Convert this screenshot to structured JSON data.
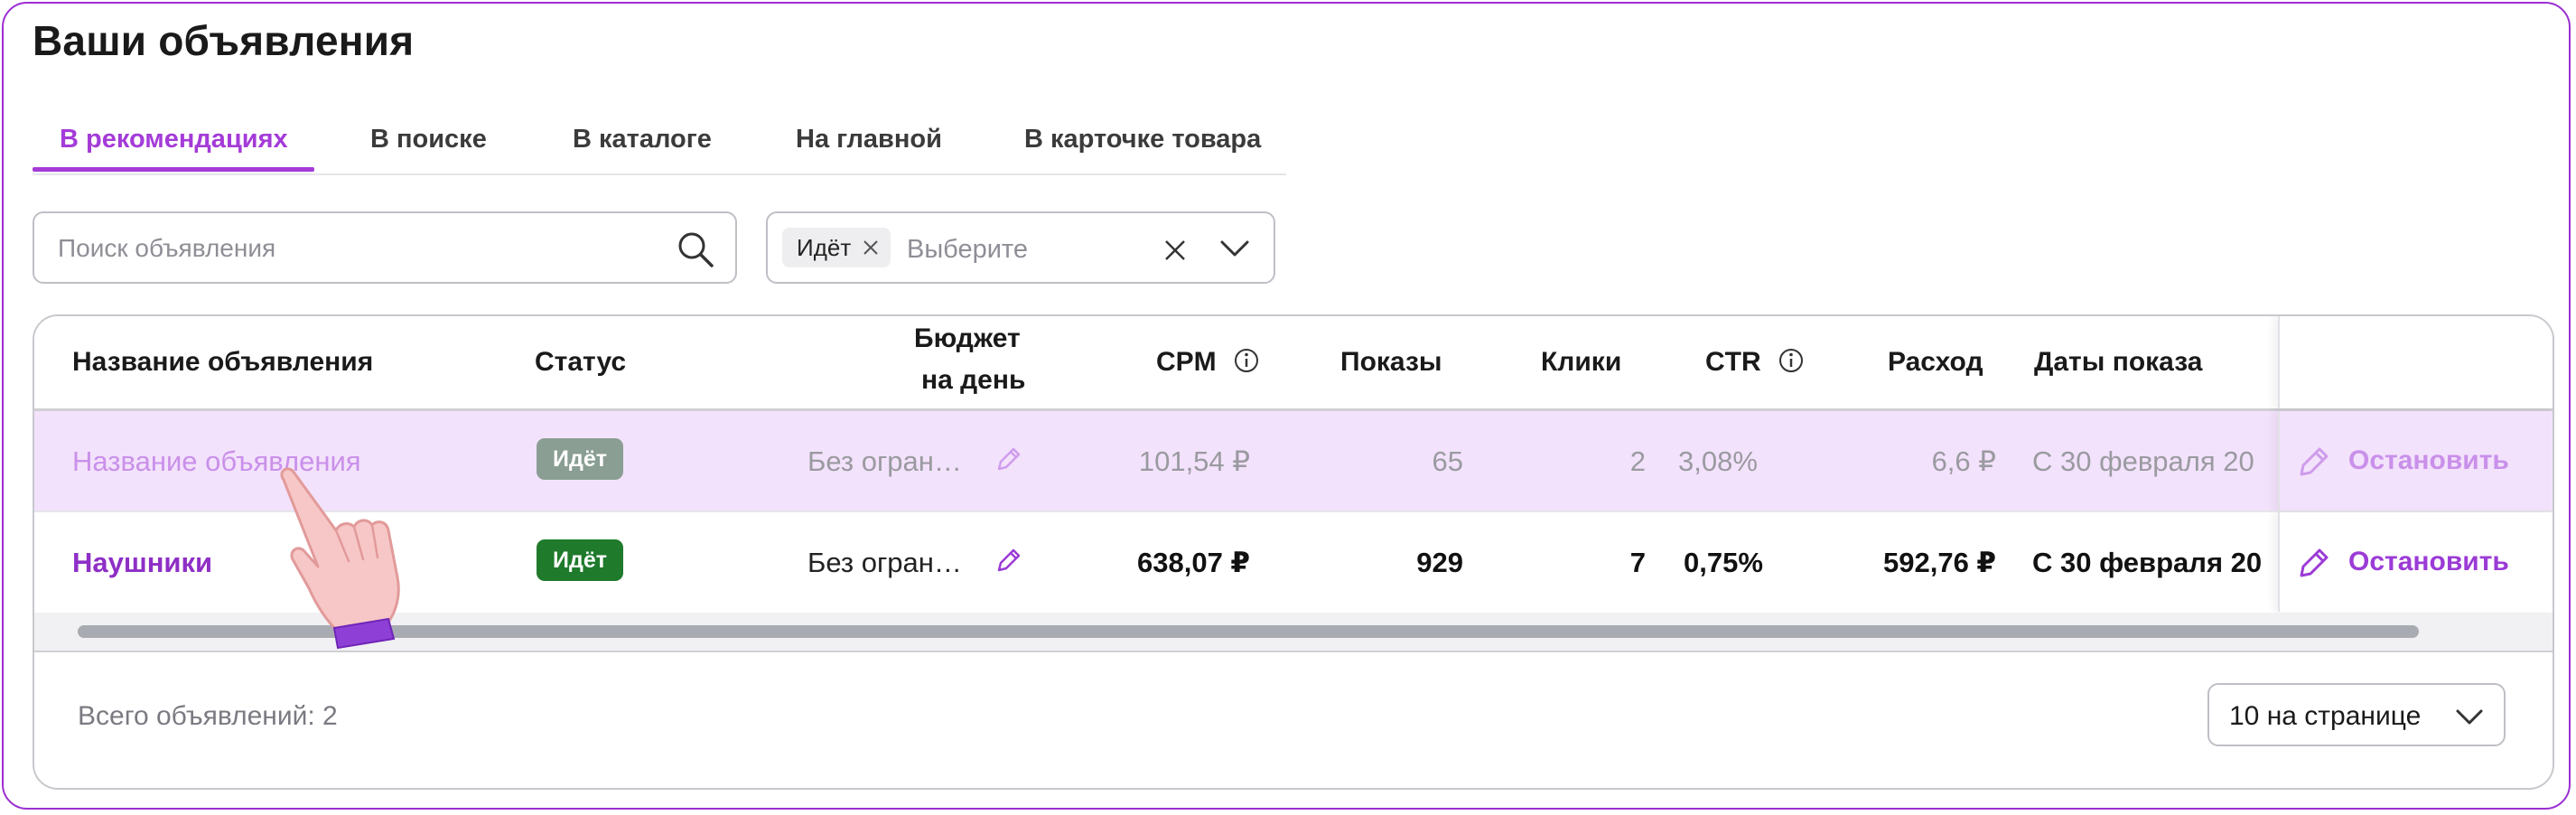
{
  "page": {
    "title": "Ваши объявления"
  },
  "tabs": [
    {
      "label": "В рекомендациях",
      "active": true
    },
    {
      "label": "В поиске",
      "active": false
    },
    {
      "label": "В каталоге",
      "active": false
    },
    {
      "label": "На главной",
      "active": false
    },
    {
      "label": "В карточке товара",
      "active": false
    }
  ],
  "search": {
    "placeholder": "Поиск объявления",
    "icon": "search-icon"
  },
  "status_filter": {
    "chip": "Идёт",
    "placeholder": "Выберите"
  },
  "table": {
    "columns": {
      "name": "Название объявления",
      "status": "Статус",
      "budget_line1": "Бюджет",
      "budget_line2": "на день",
      "cpm": "CPM",
      "impressions": "Показы",
      "clicks": "Клики",
      "ctr": "CTR",
      "spend": "Расход",
      "dates": "Даты показа"
    },
    "rows": [
      {
        "name": "Название объявления",
        "status": "Идёт",
        "budget": "Без огран…",
        "cpm": "101,54 ₽",
        "impressions": "65",
        "clicks": "2",
        "ctr": "3,08%",
        "spend": "6,6 ₽",
        "dates": "С 30 февраля 20",
        "action": "Остановить"
      },
      {
        "name": "Наушники",
        "status": "Идёт",
        "budget": "Без огран…",
        "cpm": "638,07 ₽",
        "impressions": "929",
        "clicks": "7",
        "ctr": "0,75%",
        "spend": "592,76 ₽",
        "dates": "С 30 февраля 20",
        "action": "Остановить"
      }
    ]
  },
  "footer": {
    "total": "Всего объявлений: 2",
    "per_page": "10 на странице"
  },
  "colors": {
    "accent": "#a43bd8",
    "status_active": "#1f7a2c",
    "row_highlight": "#f3e2fb"
  }
}
